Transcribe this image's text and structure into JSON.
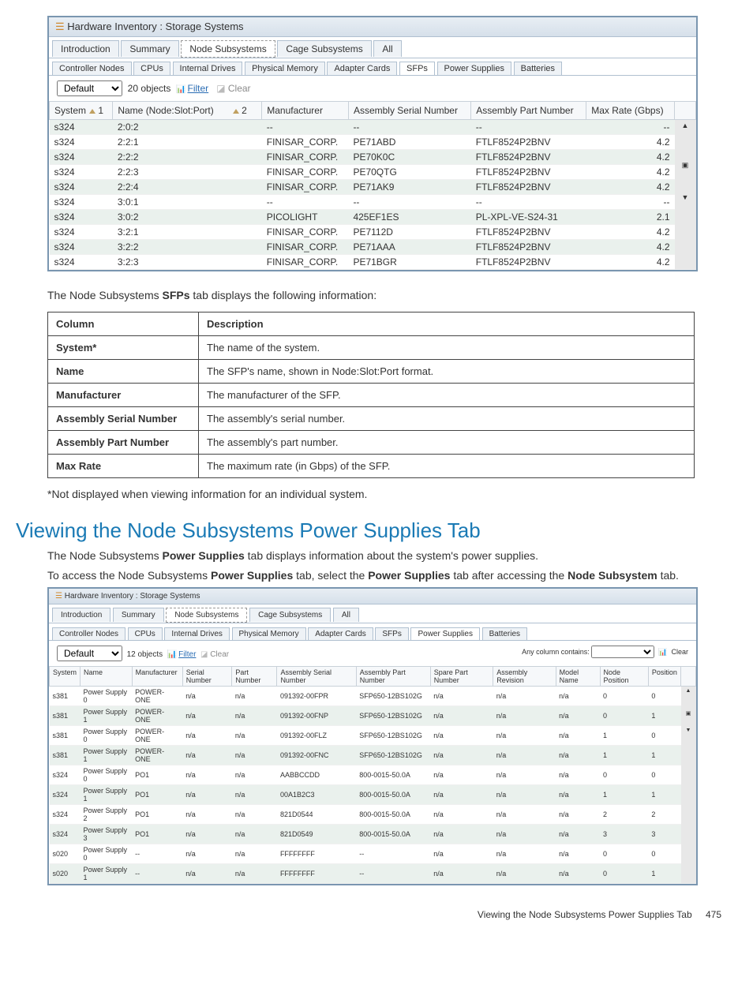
{
  "win1": {
    "title": "Hardware Inventory : Storage Systems",
    "tabs": [
      "Introduction",
      "Summary",
      "Node Subsystems",
      "Cage Subsystems",
      "All"
    ],
    "subtabs": [
      "Controller Nodes",
      "CPUs",
      "Internal Drives",
      "Physical Memory",
      "Adapter Cards",
      "SFPs",
      "Power Supplies",
      "Batteries"
    ],
    "default": "Default",
    "objcount": "20 objects",
    "filter": "Filter",
    "clear": "Clear",
    "cols": {
      "system": "System",
      "sort1": "1",
      "name": "Name (Node:Slot:Port)",
      "sort2": "2",
      "mfr": "Manufacturer",
      "asn": "Assembly Serial Number",
      "apn": "Assembly Part Number",
      "max": "Max Rate (Gbps)"
    },
    "rows": [
      {
        "sys": "s324",
        "name": "2:0:2",
        "mfr": "--",
        "asn": "--",
        "apn": "--",
        "max": "--"
      },
      {
        "sys": "s324",
        "name": "2:2:1",
        "mfr": "FINISAR_CORP.",
        "asn": "PE71ABD",
        "apn": "FTLF8524P2BNV",
        "max": "4.2"
      },
      {
        "sys": "s324",
        "name": "2:2:2",
        "mfr": "FINISAR_CORP.",
        "asn": "PE70K0C",
        "apn": "FTLF8524P2BNV",
        "max": "4.2"
      },
      {
        "sys": "s324",
        "name": "2:2:3",
        "mfr": "FINISAR_CORP.",
        "asn": "PE70QTG",
        "apn": "FTLF8524P2BNV",
        "max": "4.2"
      },
      {
        "sys": "s324",
        "name": "2:2:4",
        "mfr": "FINISAR_CORP.",
        "asn": "PE71AK9",
        "apn": "FTLF8524P2BNV",
        "max": "4.2"
      },
      {
        "sys": "s324",
        "name": "3:0:1",
        "mfr": "--",
        "asn": "--",
        "apn": "--",
        "max": "--"
      },
      {
        "sys": "s324",
        "name": "3:0:2",
        "mfr": "PICOLIGHT",
        "asn": "425EF1ES",
        "apn": "PL-XPL-VE-S24-31",
        "max": "2.1"
      },
      {
        "sys": "s324",
        "name": "3:2:1",
        "mfr": "FINISAR_CORP.",
        "asn": "PE7112D",
        "apn": "FTLF8524P2BNV",
        "max": "4.2"
      },
      {
        "sys": "s324",
        "name": "3:2:2",
        "mfr": "FINISAR_CORP.",
        "asn": "PE71AAA",
        "apn": "FTLF8524P2BNV",
        "max": "4.2"
      },
      {
        "sys": "s324",
        "name": "3:2:3",
        "mfr": "FINISAR_CORP.",
        "asn": "PE71BGR",
        "apn": "FTLF8524P2BNV",
        "max": "4.2"
      }
    ]
  },
  "intro1": "The Node Subsystems SFPs tab displays the following information:",
  "desc": {
    "head_col": "Column",
    "head_desc": "Description",
    "rows": [
      {
        "c": "System*",
        "d": "The name of the system."
      },
      {
        "c": "Name",
        "d": "The SFP's name, shown in Node:Slot:Port format."
      },
      {
        "c": "Manufacturer",
        "d": "The manufacturer of the SFP."
      },
      {
        "c": "Assembly Serial Number",
        "d": "The assembly's serial number."
      },
      {
        "c": "Assembly Part Number",
        "d": "The assembly's part number."
      },
      {
        "c": "Max Rate",
        "d": "The maximum rate (in Gbps) of the SFP."
      }
    ],
    "note": "*Not displayed when viewing information for an individual system."
  },
  "heading": "Viewing the Node Subsystems Power Supplies Tab",
  "para1a": "The Node Subsystems ",
  "para1b": "Power Supplies",
  "para1c": " tab displays information about the system's power supplies.",
  "para2a": "To access the Node Subsystems ",
  "para2b": "Power Supplies",
  "para2c": " tab, select the ",
  "para2d": "Power Supplies",
  "para2e": " tab after accessing the ",
  "para2f": "Node Subsystem",
  "para2g": " tab.",
  "win2": {
    "title": "Hardware Inventory : Storage Systems",
    "tabs": [
      "Introduction",
      "Summary",
      "Node Subsystems",
      "Cage Subsystems",
      "All"
    ],
    "subtabs": [
      "Controller Nodes",
      "CPUs",
      "Internal Drives",
      "Physical Memory",
      "Adapter Cards",
      "SFPs",
      "Power Supplies",
      "Batteries"
    ],
    "default": "Default",
    "objcount": "12 objects",
    "filter": "Filter",
    "clear": "Clear",
    "anycol": "Any column contains:",
    "clear2": "Clear",
    "cols": [
      "System",
      "Name",
      "Manufacturer",
      "Serial Number",
      "Part Number",
      "Assembly Serial Number",
      "Assembly Part Number",
      "Spare Part Number",
      "Assembly Revision",
      "Model Name",
      "Node Position",
      "Position"
    ],
    "rows": [
      {
        "v": [
          "s381",
          "Power Supply 0",
          "POWER-ONE",
          "n/a",
          "n/a",
          "091392-00FPR",
          "SFP650-12BS102G",
          "n/a",
          "n/a",
          "n/a",
          "0",
          "0"
        ]
      },
      {
        "v": [
          "s381",
          "Power Supply 1",
          "POWER-ONE",
          "n/a",
          "n/a",
          "091392-00FNP",
          "SFP650-12BS102G",
          "n/a",
          "n/a",
          "n/a",
          "0",
          "1"
        ]
      },
      {
        "v": [
          "s381",
          "Power Supply 0",
          "POWER-ONE",
          "n/a",
          "n/a",
          "091392-00FLZ",
          "SFP650-12BS102G",
          "n/a",
          "n/a",
          "n/a",
          "1",
          "0"
        ]
      },
      {
        "v": [
          "s381",
          "Power Supply 1",
          "POWER-ONE",
          "n/a",
          "n/a",
          "091392-00FNC",
          "SFP650-12BS102G",
          "n/a",
          "n/a",
          "n/a",
          "1",
          "1"
        ]
      },
      {
        "v": [
          "s324",
          "Power Supply 0",
          "PO1",
          "n/a",
          "n/a",
          "AABBCCDD",
          "800-0015-50.0A",
          "n/a",
          "n/a",
          "n/a",
          "0",
          "0"
        ]
      },
      {
        "v": [
          "s324",
          "Power Supply 1",
          "PO1",
          "n/a",
          "n/a",
          "00A1B2C3",
          "800-0015-50.0A",
          "n/a",
          "n/a",
          "n/a",
          "1",
          "1"
        ]
      },
      {
        "v": [
          "s324",
          "Power Supply 2",
          "PO1",
          "n/a",
          "n/a",
          "821D0544",
          "800-0015-50.0A",
          "n/a",
          "n/a",
          "n/a",
          "2",
          "2"
        ]
      },
      {
        "v": [
          "s324",
          "Power Supply 3",
          "PO1",
          "n/a",
          "n/a",
          "821D0549",
          "800-0015-50.0A",
          "n/a",
          "n/a",
          "n/a",
          "3",
          "3"
        ]
      },
      {
        "v": [
          "s020",
          "Power Supply 0",
          "--",
          "n/a",
          "n/a",
          "FFFFFFFF",
          "--",
          "n/a",
          "n/a",
          "n/a",
          "0",
          "0"
        ]
      },
      {
        "v": [
          "s020",
          "Power Supply 1",
          "--",
          "n/a",
          "n/a",
          "FFFFFFFF",
          "--",
          "n/a",
          "n/a",
          "n/a",
          "0",
          "1"
        ]
      }
    ]
  },
  "footer": "Viewing the Node Subsystems Power Supplies Tab",
  "page": "475"
}
